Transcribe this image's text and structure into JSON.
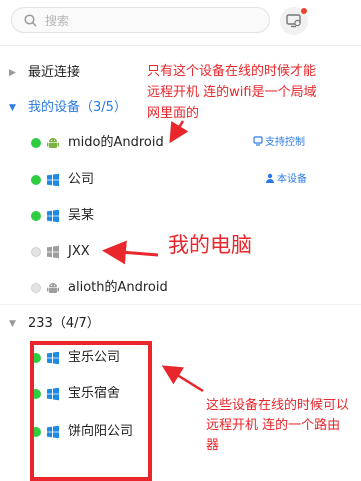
{
  "search": {
    "placeholder": "搜索",
    "icon": "search-icon"
  },
  "header": {
    "device_button_icon": "monitor-settings-icon",
    "badge_color": "#e8432e"
  },
  "groups": [
    {
      "label": "最近连接",
      "expanded": false,
      "accent": false
    },
    {
      "label": "我的设备（3/5）",
      "expanded": true,
      "accent": true
    },
    {
      "label": "233（4/7）",
      "expanded": true,
      "accent": false
    }
  ],
  "devices": [
    {
      "name": "mido的Android",
      "os": "android",
      "online": true,
      "tag": "支持控制",
      "tag_icon": "remote-control-icon"
    },
    {
      "name": "公司",
      "os": "windows",
      "online": true,
      "tag": "本设备",
      "tag_icon": "user-icon"
    },
    {
      "name": "吴某",
      "os": "windows",
      "online": true
    },
    {
      "name": "JXX",
      "os": "windows",
      "online": false
    },
    {
      "name": "alioth的Android",
      "os": "android",
      "online": false
    },
    {
      "name": "宝乐公司",
      "os": "windows",
      "online": true
    },
    {
      "name": "宝乐宿舍",
      "os": "windows",
      "online": true
    },
    {
      "name": "饼向阳公司",
      "os": "windows",
      "online": true
    }
  ],
  "annotations": {
    "note1": [
      "只有这个设备在线的时候才能",
      "远程开机 连的wifi是一个局域",
      "网里面的"
    ],
    "note2": "我的电脑",
    "note3": [
      "这些设备在线的时候可以",
      "远程开机 连的一个路由",
      "器"
    ]
  },
  "colors": {
    "accent": "#2c7be5",
    "online": "#2ecc40",
    "annotation": "#e8262b"
  }
}
